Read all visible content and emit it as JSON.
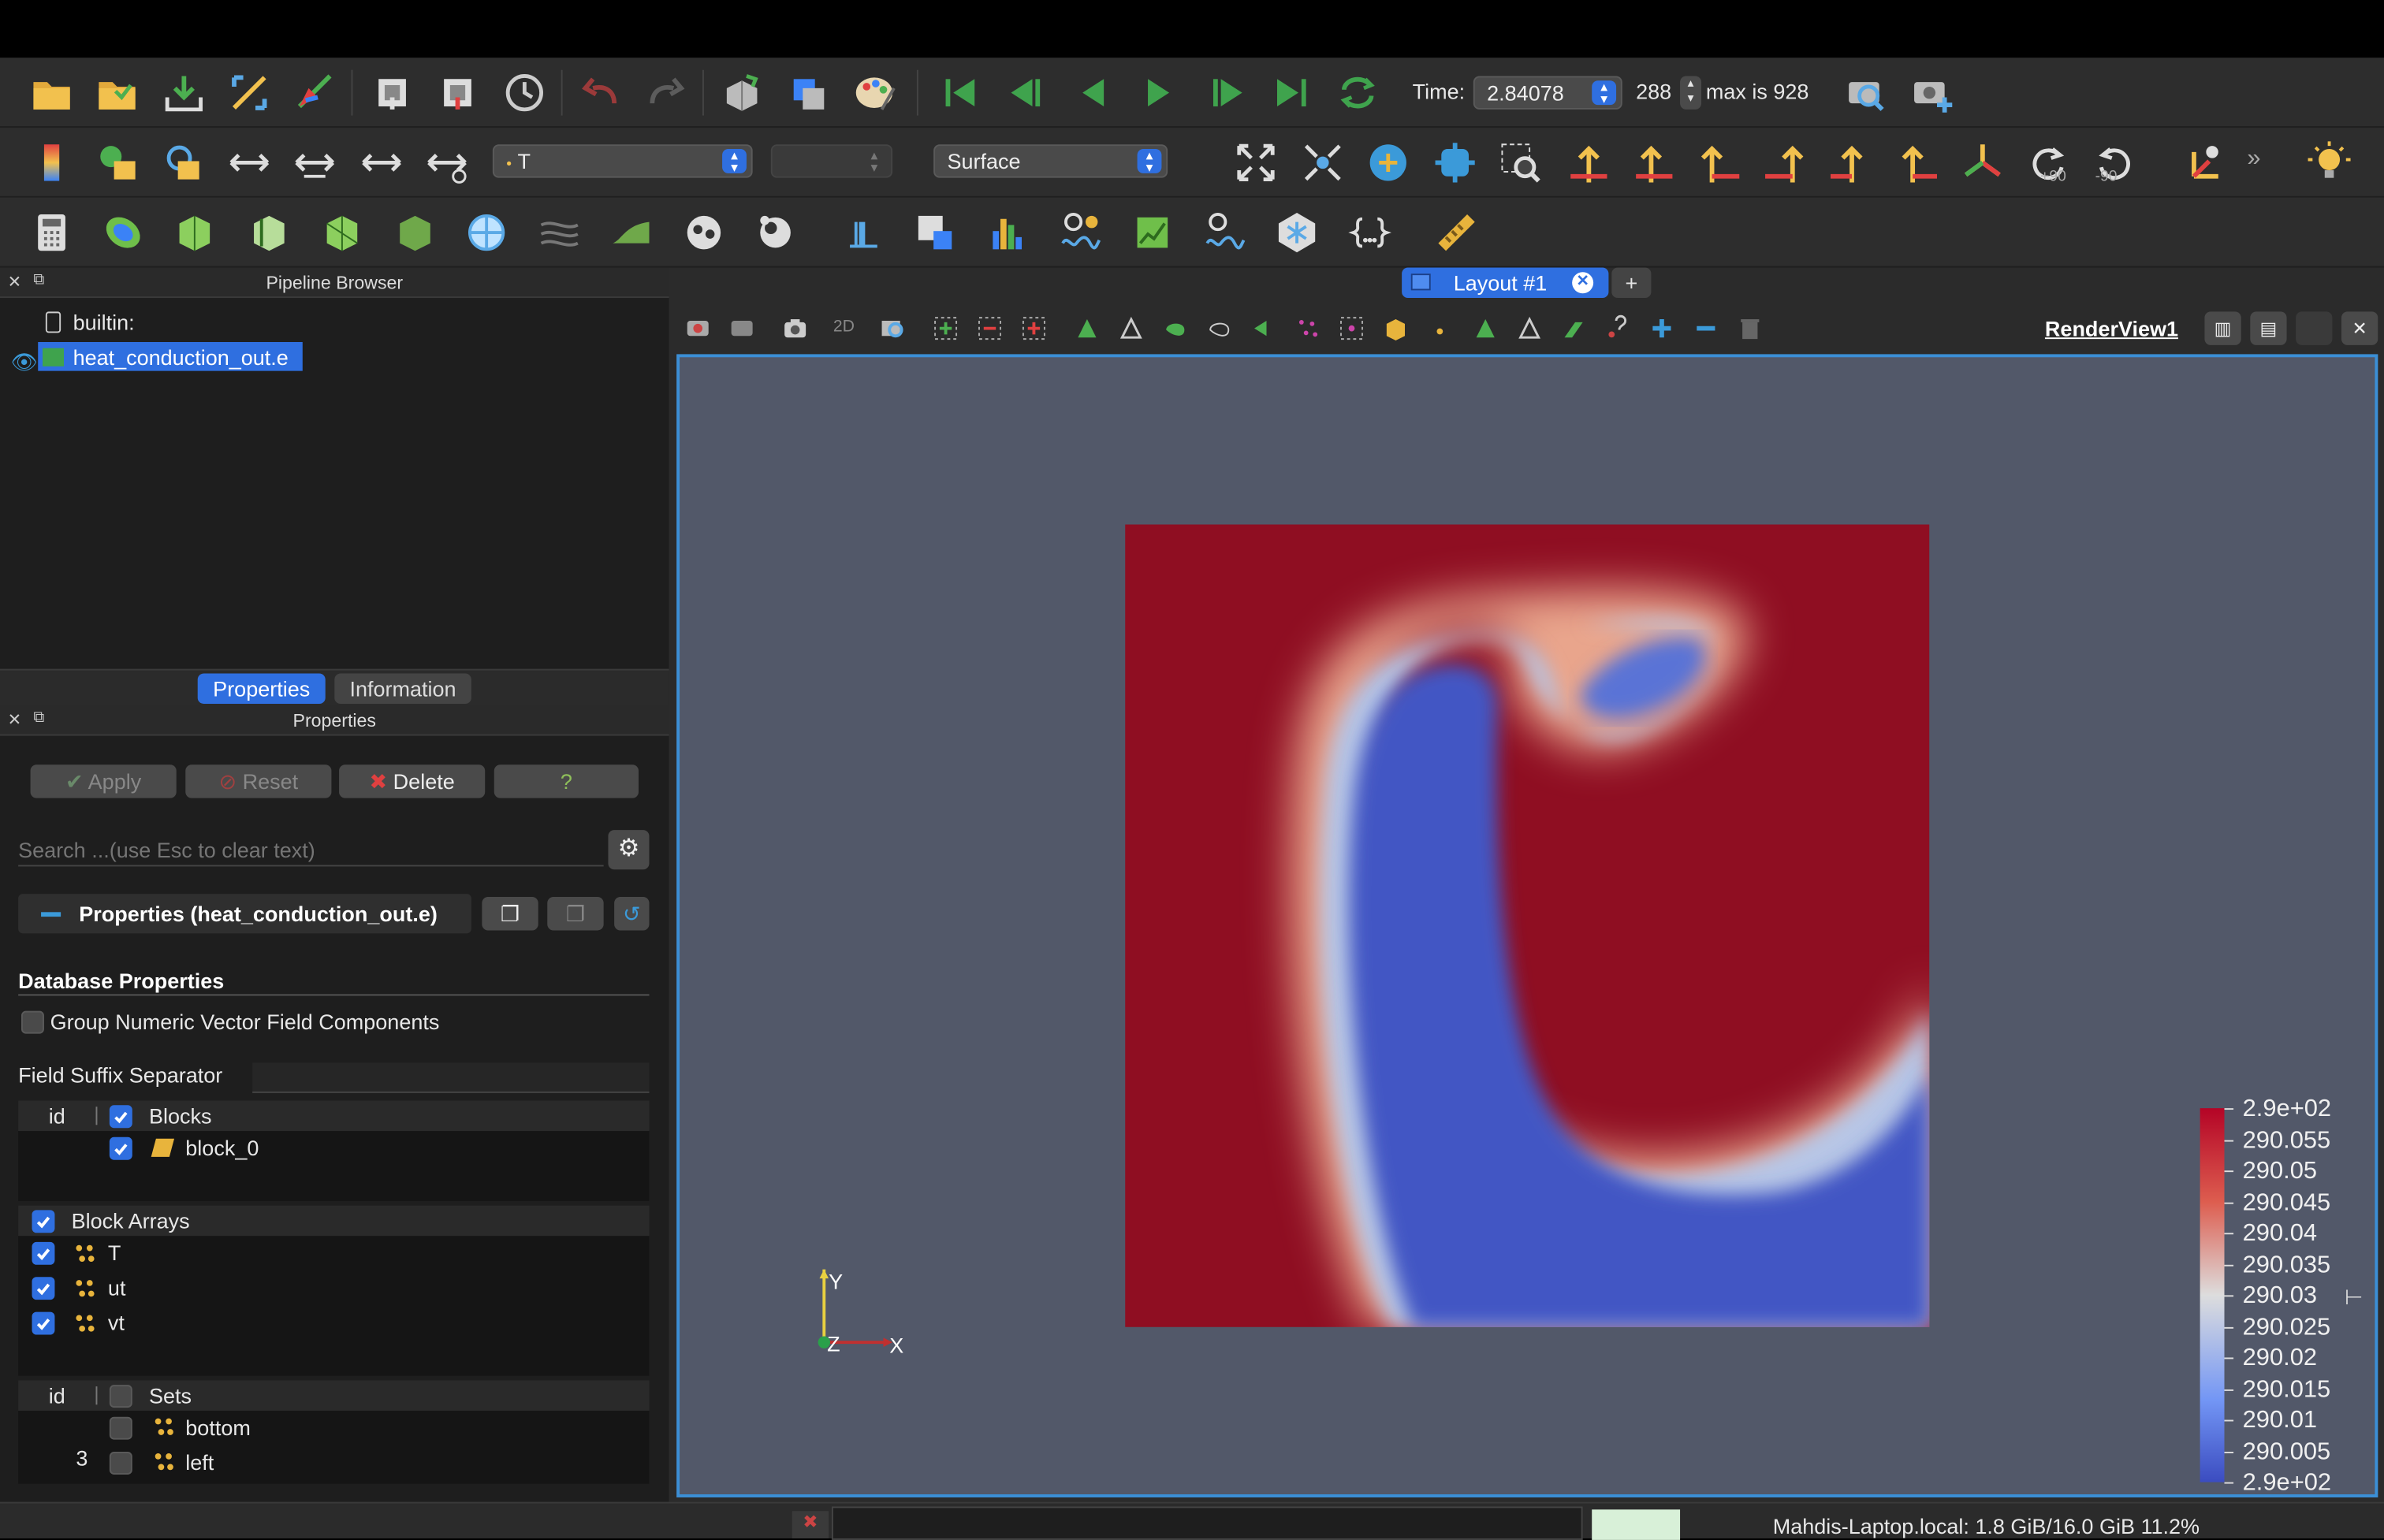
{
  "toolbar": {
    "time_label": "Time:",
    "time_value": "2.84078",
    "timestep_value": "288",
    "max_label": "max is 928",
    "field_value": "T",
    "component_value": "",
    "representation_value": "Surface",
    "rot_plus_label": "+90",
    "rot_minus_label": "-90",
    "axis_labels": [
      "+X",
      "-X",
      "+Y",
      "-Y",
      "+Z",
      "-Z"
    ]
  },
  "pipeline": {
    "title": "Pipeline Browser",
    "root_label": "builtin:",
    "item_label": "heat_conduction_out.e"
  },
  "tabs": {
    "properties": "Properties",
    "information": "Information"
  },
  "properties": {
    "title": "Properties",
    "apply": "Apply",
    "reset": "Reset",
    "delete": "Delete",
    "help": "?",
    "search_placeholder": "Search ...(use Esc to clear text)",
    "section_header": "Properties (heat_conduction_out.e)",
    "database_header": "Database Properties",
    "group_numeric": "Group Numeric Vector Field Components",
    "field_suffix": "Field Suffix Separator",
    "blocks_col_id": "id",
    "blocks_col_name": "Blocks",
    "block_item": "block_0",
    "block_arrays_header": "Block Arrays",
    "block_arrays": [
      "T",
      "ut",
      "vt"
    ],
    "sets_col_id": "id",
    "sets_col_name": "Sets",
    "sets": [
      {
        "id": "",
        "name": "bottom"
      },
      {
        "id": "3",
        "name": "left"
      }
    ]
  },
  "layout": {
    "tab_label": "Layout #1",
    "add_tab": "+",
    "view_name": "RenderView1",
    "mode_2d": "2D"
  },
  "colorbar": {
    "labels": [
      "2.9e+02",
      "290.055",
      "290.05",
      "290.045",
      "290.04",
      "290.035",
      "290.03",
      "290.025",
      "290.02",
      "290.015",
      "290.01",
      "290.005",
      "2.9e+02"
    ]
  },
  "axes": {
    "y": "Y",
    "z": "Z",
    "x": "X"
  },
  "status": {
    "memory": "Mahdis-Laptop.local: 1.8 GiB/16.0 GiB 11.2%"
  },
  "colors": {
    "hot": "#8f0e22",
    "cold": "#3b4cc0",
    "background": "#525869",
    "accent": "#2f6fe0"
  }
}
